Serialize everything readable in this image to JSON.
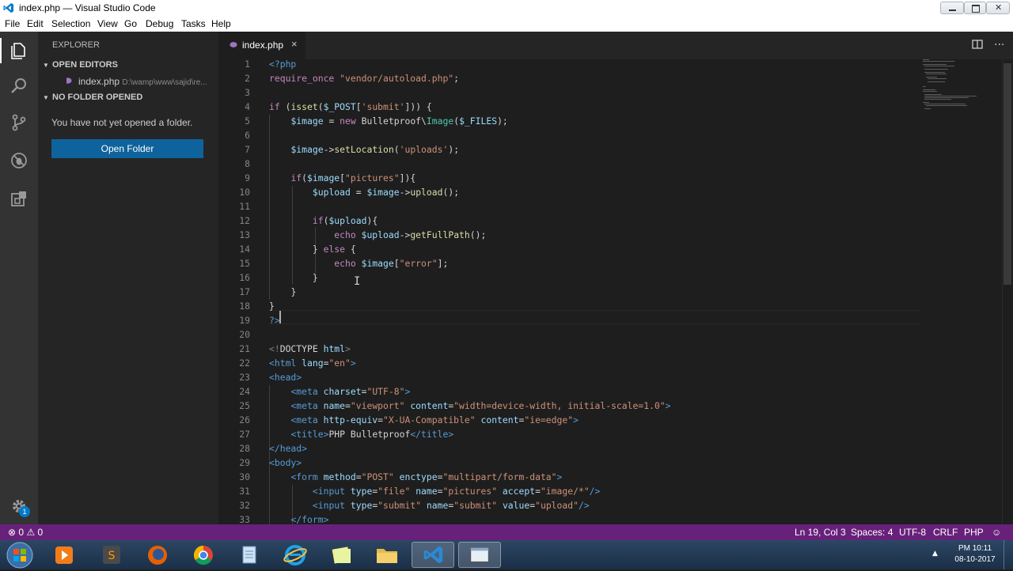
{
  "window": {
    "title": "index.php — Visual Studio Code"
  },
  "menu": [
    "File",
    "Edit",
    "Selection",
    "View",
    "Go",
    "Debug",
    "Tasks",
    "Help"
  ],
  "sidebar": {
    "header": "EXPLORER",
    "open_editors": "OPEN EDITORS",
    "file_name": "index.php",
    "file_path": "D:\\wamp\\www\\sajid\\re...",
    "no_folder": "NO FOLDER OPENED",
    "message": "You have not yet opened a folder.",
    "open_folder_button": "Open Folder"
  },
  "tab": {
    "label": "index.php",
    "close": "×"
  },
  "editor": {
    "line_numbers": [
      "1",
      "2",
      "3",
      "4",
      "5",
      "6",
      "7",
      "8",
      "9",
      "10",
      "11",
      "12",
      "13",
      "14",
      "15",
      "16",
      "17",
      "18",
      "19",
      "20",
      "21",
      "22",
      "23",
      "24",
      "25",
      "26",
      "27",
      "28",
      "29",
      "30",
      "31",
      "32",
      "33"
    ],
    "code": {
      "l1": "<?php",
      "l2a": "require_once",
      "l2b": "\"vendor/autoload.php\"",
      "l2c": ";",
      "l4a": "if",
      "l4b": " (",
      "l4c": "isset",
      "l4d": "(",
      "l4e": "$_POST",
      "l4f": "[",
      "l4g": "'submit'",
      "l4h": "])) {",
      "l5a": "$image",
      "l5b": " = ",
      "l5c": "new",
      "l5d": " Bulletproof\\",
      "l5e": "Image",
      "l5f": "(",
      "l5g": "$_FILES",
      "l5h": ");",
      "l7a": "$image",
      "l7b": "->",
      "l7c": "setLocation",
      "l7d": "(",
      "l7e": "'uploads'",
      "l7f": ");",
      "l9a": "if",
      "l9b": "(",
      "l9c": "$image",
      "l9d": "[",
      "l9e": "\"pictures\"",
      "l9f": "]){",
      "l10a": "$upload",
      "l10b": " = ",
      "l10c": "$image",
      "l10d": "->",
      "l10e": "upload",
      "l10f": "();",
      "l12a": "if",
      "l12b": "(",
      "l12c": "$upload",
      "l12d": "){",
      "l13a": "echo",
      "l13b": " ",
      "l13c": "$upload",
      "l13d": "->",
      "l13e": "getFullPath",
      "l13f": "();",
      "l14a": "} ",
      "l14b": "else",
      "l14c": " {",
      "l15a": "echo",
      "l15b": " ",
      "l15c": "$image",
      "l15d": "[",
      "l15e": "\"error\"",
      "l15f": "];",
      "l16": "}",
      "l17": "}",
      "l18": "}",
      "l19": "?>",
      "l21a": "<!",
      "l21b": "DOCTYPE",
      "l21c": " html",
      "l21d": ">",
      "l22a": "<html",
      "l22b": " lang",
      "l22c": "=",
      "l22d": "\"en\"",
      "l22e": ">",
      "l23": "<head>",
      "l24a": "<meta",
      "l24b": " charset",
      "l24c": "=",
      "l24d": "\"UTF-8\"",
      "l24e": ">",
      "l25a": "<meta",
      "l25b": " name",
      "l25c": "=",
      "l25d": "\"viewport\"",
      "l25e": " content",
      "l25f": "=",
      "l25g": "\"width=device-width, initial-scale=1.0\"",
      "l25h": ">",
      "l26a": "<meta",
      "l26b": " http-equiv",
      "l26c": "=",
      "l26d": "\"X-UA-Compatible\"",
      "l26e": " content",
      "l26f": "=",
      "l26g": "\"ie=edge\"",
      "l26h": ">",
      "l27a": "<title>",
      "l27b": "PHP Bulletproof",
      "l27c": "</title>",
      "l28": "</head>",
      "l29": "<body>",
      "l30a": "<form",
      "l30b": " method",
      "l30c": "=",
      "l30d": "\"POST\"",
      "l30e": " enctype",
      "l30f": "=",
      "l30g": "\"multipart/form-data\"",
      "l30h": ">",
      "l31a": "<input",
      "l31b": " type",
      "l31c": "=",
      "l31d": "\"file\"",
      "l31e": " name",
      "l31f": "=",
      "l31g": "\"pictures\"",
      "l31h": " accept",
      "l31i": "=",
      "l31j": "\"image/*\"",
      "l31k": "/>",
      "l32a": "<input",
      "l32b": " type",
      "l32c": "=",
      "l32d": "\"submit\"",
      "l32e": " name",
      "l32f": "=",
      "l32g": "\"submit\"",
      "l32h": " value",
      "l32i": "=",
      "l32j": "\"upload\"",
      "l32k": "/>",
      "l33": "</form>"
    }
  },
  "statusbar": {
    "errors": "0",
    "warnings": "0",
    "position": "Ln 19, Col 3",
    "spaces": "Spaces: 4",
    "encoding": "UTF-8",
    "eol": "CRLF",
    "language": "PHP"
  },
  "activity": {
    "settings_badge": "1"
  },
  "taskbar": {
    "time": "PM 10:11",
    "date": "08-10-2017"
  },
  "colors": {
    "statusbar": "#68217a",
    "accent": "#0e639c",
    "editor_bg": "#1e1e1e"
  }
}
